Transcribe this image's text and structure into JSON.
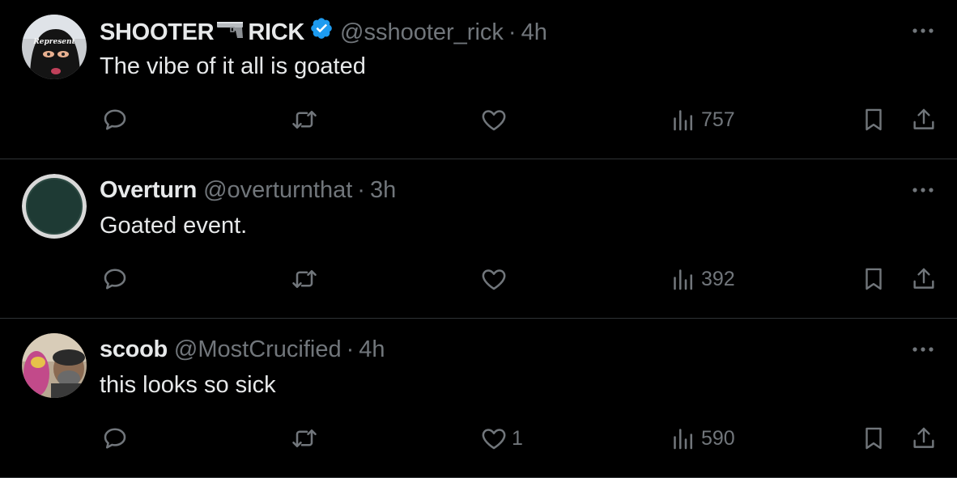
{
  "tweets": [
    {
      "name_part1": "SHOOTER",
      "name_part2": "RICK",
      "handle": "@sshooter_rick",
      "separator": "·",
      "time": "4h",
      "text": "The vibe of it all is goated",
      "likes": "",
      "views": "757",
      "avatar_caption": "Represent"
    },
    {
      "name": "Overturn",
      "handle": "@overturnthat",
      "separator": "·",
      "time": "3h",
      "text": "Goated event.",
      "likes": "",
      "views": "392"
    },
    {
      "name": "scoob",
      "handle": "@MostCrucified",
      "separator": "·",
      "time": "4h",
      "text": "this looks so sick",
      "likes": "1",
      "views": "590"
    }
  ],
  "colors": {
    "background": "#000000",
    "primary_text": "#e7e9ea",
    "secondary_text": "#71767b",
    "divider": "#2f3336",
    "verified": "#1d9bf0"
  },
  "icons": [
    "more-icon",
    "reply-icon",
    "retweet-icon",
    "like-icon",
    "views-icon",
    "bookmark-icon",
    "share-icon",
    "verified-icon",
    "pistol-icon"
  ]
}
